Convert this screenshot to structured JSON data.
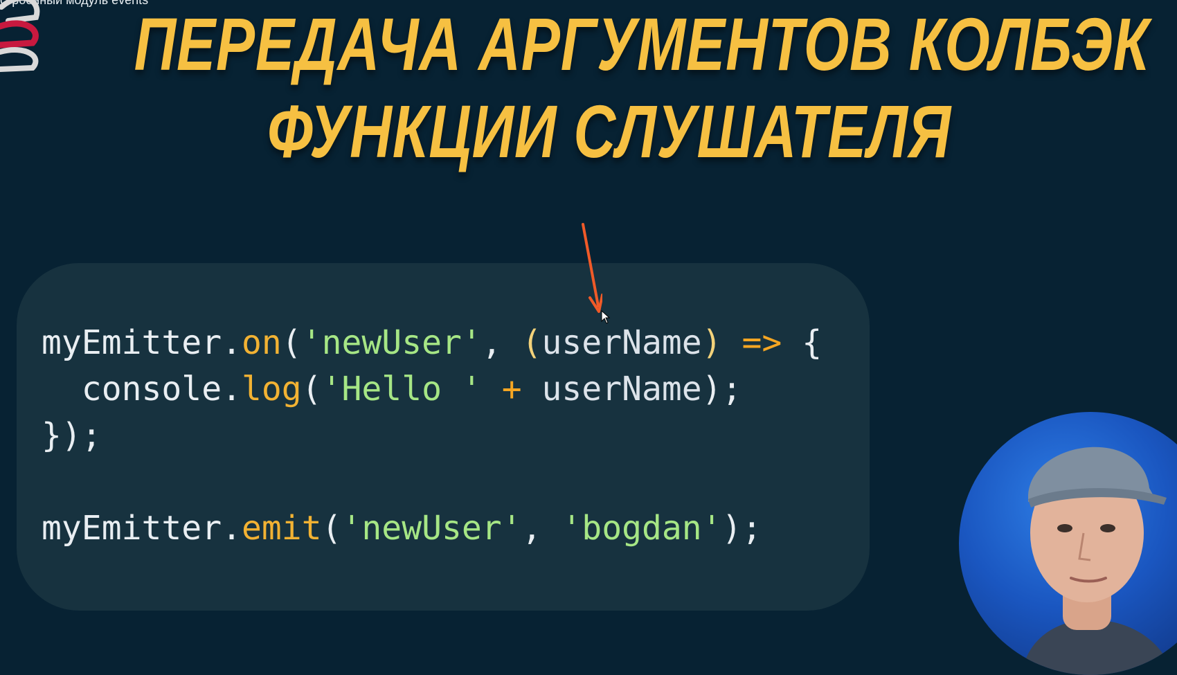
{
  "video": {
    "caption": "строенный модуль events"
  },
  "slide": {
    "title_line1": "ПЕРЕДАЧА АРГУМЕНТОВ КОЛБЭК",
    "title_line2": "ФУНКЦИИ  СЛУШАТЕЛЯ",
    "code": {
      "line1": {
        "obj": "myEmitter",
        "dot": ".",
        "method": "on",
        "open": "(",
        "event": "'newUser'",
        "comma": ", ",
        "paren_open": "(",
        "param": "userName",
        "paren_close": ")",
        "space": " ",
        "arrow": "=>",
        "brace": " {"
      },
      "line2": {
        "indent": "  ",
        "obj": "console",
        "dot": ".",
        "method": "log",
        "open": "(",
        "str": "'Hello '",
        "plus": " + ",
        "var": "userName",
        "close": ");"
      },
      "line3": {
        "close": "});"
      },
      "line5": {
        "obj": "myEmitter",
        "dot": ".",
        "method": "emit",
        "open": "(",
        "event": "'newUser'",
        "comma": ", ",
        "arg": "'bogdan'",
        "close": ");"
      }
    }
  },
  "colors": {
    "background": "#072233",
    "title": "#f6c042",
    "code_card": "#17323f",
    "function": "#f2b233",
    "string": "#a6e685",
    "arrow": "#f05a28"
  },
  "icons": {
    "logo": "brand-logo-icon",
    "annotation": "red-arrow-annotation",
    "cursor": "mouse-cursor-icon"
  }
}
